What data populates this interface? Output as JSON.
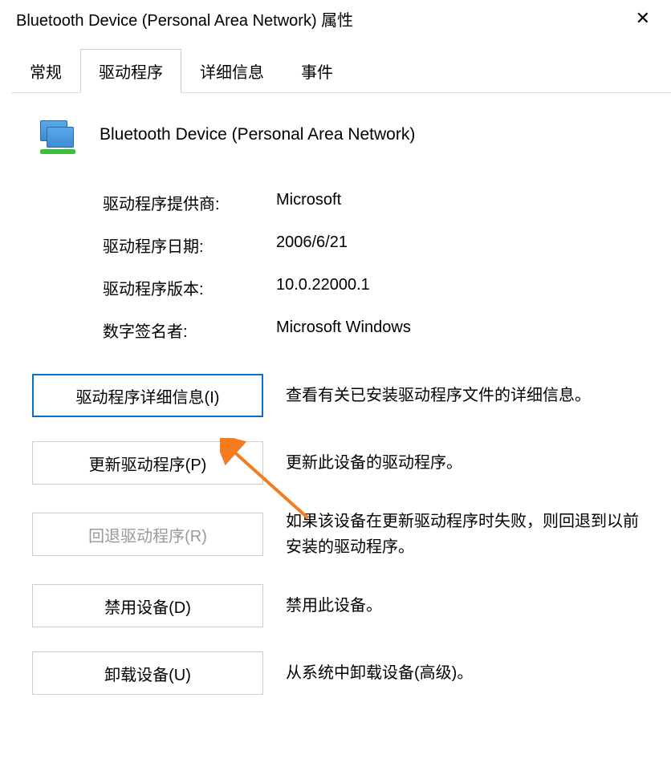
{
  "titlebar": {
    "title": "Bluetooth Device (Personal Area Network) 属性",
    "close_icon": "✕"
  },
  "tabs": {
    "items": [
      {
        "label": "常规",
        "active": false
      },
      {
        "label": "驱动程序",
        "active": true
      },
      {
        "label": "详细信息",
        "active": false
      },
      {
        "label": "事件",
        "active": false
      }
    ]
  },
  "device": {
    "name": "Bluetooth Device (Personal Area Network)"
  },
  "info": {
    "rows": [
      {
        "label": "驱动程序提供商:",
        "value": "Microsoft"
      },
      {
        "label": "驱动程序日期:",
        "value": "2006/6/21"
      },
      {
        "label": "驱动程序版本:",
        "value": "10.0.22000.1"
      },
      {
        "label": "数字签名者:",
        "value": "Microsoft Windows"
      }
    ]
  },
  "actions": {
    "rows": [
      {
        "button": "驱动程序详细信息(I)",
        "desc": "查看有关已安装驱动程序文件的详细信息。",
        "focused": true,
        "disabled": false
      },
      {
        "button": "更新驱动程序(P)",
        "desc": "更新此设备的驱动程序。",
        "focused": false,
        "disabled": false
      },
      {
        "button": "回退驱动程序(R)",
        "desc": "如果该设备在更新驱动程序时失败，则回退到以前安装的驱动程序。",
        "focused": false,
        "disabled": true
      },
      {
        "button": "禁用设备(D)",
        "desc": "禁用此设备。",
        "focused": false,
        "disabled": false
      },
      {
        "button": "卸载设备(U)",
        "desc": "从系统中卸载设备(高级)。",
        "focused": false,
        "disabled": false
      }
    ]
  },
  "annotation": {
    "color": "#f57c1f"
  }
}
